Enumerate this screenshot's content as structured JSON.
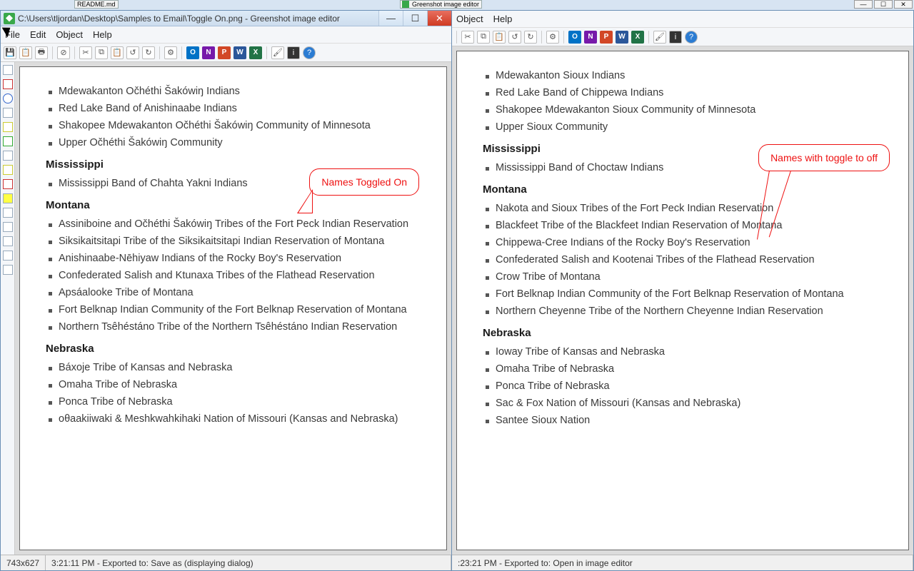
{
  "background": {
    "tab1": "README.md",
    "title_partial": "Greenshot image editor"
  },
  "bg_winbtns": [
    "—",
    "☐",
    "✕"
  ],
  "window_left": {
    "title": "C:\\Users\\tljordan\\Desktop\\Samples to Email\\Toggle On.png - Greenshot image editor",
    "menus": [
      "File",
      "Edit",
      "Object",
      "Help"
    ],
    "apps": [
      "O",
      "N",
      "P",
      "W",
      "X"
    ],
    "status_dim": "743x627",
    "status_msg": "3:21:11 PM - Exported to: Save as (displaying dialog)",
    "callout": "Names Toggled On",
    "sections": [
      {
        "items": [
          "Mdewakanton Očhéthi Šakówiŋ Indians",
          "Red Lake Band of Anishinaabe Indians",
          "Shakopee Mdewakanton Očhéthi Šakówiŋ Community of Minnesota",
          "Upper Očhéthi Šakówiŋ Community"
        ]
      },
      {
        "heading": "Mississippi",
        "items": [
          "Mississippi Band of Chahta Yakni Indians"
        ]
      },
      {
        "heading": "Montana",
        "items": [
          "Assiniboine and Očhéthi Šakówiŋ Tribes of the Fort Peck Indian Reservation",
          "Siksikaitsitapi Tribe of the Siksikaitsitapi Indian Reservation of Montana",
          "Anishinaabe-Nēhiyaw Indians of the Rocky Boy's Reservation",
          "Confederated Salish and Ktunaxa Tribes of the Flathead Reservation",
          "Apsáalooke Tribe of Montana",
          "Fort Belknap Indian Community of the Fort Belknap Reservation of Montana",
          "Northern Tsêhéstáno Tribe of the Northern Tsêhéstáno Indian Reservation"
        ]
      },
      {
        "heading": "Nebraska",
        "items": [
          "Báxoje Tribe of Kansas and Nebraska",
          "Omaha Tribe of Nebraska",
          "Ponca Tribe of Nebraska",
          "oθaakiiwaki & Meshkwahkihaki Nation of Missouri (Kansas and Nebraska)"
        ]
      }
    ]
  },
  "window_right": {
    "menus": [
      "Object",
      "Help"
    ],
    "apps": [
      "O",
      "N",
      "P",
      "W",
      "X"
    ],
    "status_msg": ":23:21 PM - Exported to: Open in image editor",
    "callout": "Names with toggle to off",
    "sections": [
      {
        "items": [
          "Mdewakanton Sioux Indians",
          "Red Lake Band of Chippewa Indians",
          "Shakopee Mdewakanton Sioux Community of Minnesota",
          "Upper Sioux Community"
        ]
      },
      {
        "heading": "Mississippi",
        "items": [
          "Mississippi Band of Choctaw Indians"
        ]
      },
      {
        "heading": "Montana",
        "items": [
          "Nakota and Sioux Tribes of the Fort Peck Indian Reservation",
          "Blackfeet Tribe of the Blackfeet Indian Reservation of Montana",
          "Chippewa-Cree Indians of the Rocky Boy's Reservation",
          "Confederated Salish and Kootenai Tribes of the Flathead Reservation",
          "Crow Tribe of Montana",
          "Fort Belknap Indian Community of the Fort Belknap Reservation of Montana",
          "Northern Cheyenne Tribe of the Northern Cheyenne Indian Reservation"
        ]
      },
      {
        "heading": "Nebraska",
        "items": [
          "Ioway Tribe of Kansas and Nebraska",
          "Omaha Tribe of Nebraska",
          "Ponca Tribe of Nebraska",
          "Sac & Fox Nation of Missouri (Kansas and Nebraska)",
          "Santee Sioux Nation"
        ]
      }
    ]
  }
}
